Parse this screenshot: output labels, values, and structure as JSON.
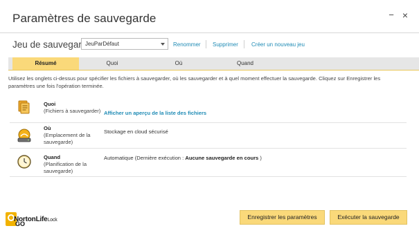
{
  "window": {
    "title": "Paramètres de sauvegarde",
    "minimize_glyph": "−",
    "close_glyph": "×"
  },
  "backup_set": {
    "label": "Jeu de sauvegarde",
    "selected": "JeuParDéfaut",
    "links": [
      "Renommer",
      "Supprimer",
      "Créer un nouveau jeu"
    ]
  },
  "tabs": [
    {
      "label": "Résumé",
      "active": true
    },
    {
      "label": "Quoi",
      "active": false
    },
    {
      "label": "Où",
      "active": false
    },
    {
      "label": "Quand",
      "active": false
    }
  ],
  "description": "Utilisez les onglets ci-dessus pour spécifier les fichiers à sauvegarder, où les sauvegarder et à quel moment effectuer la sauvegarde. Cliquez sur Enregistrer les paramètres une fois l'opération terminée.",
  "rows": {
    "what": {
      "title": "Quoi",
      "subtitle": "(Fichiers à sauvegarder)",
      "link": "Afficher un aperçu de la liste des fichiers",
      "icon": "files-icon"
    },
    "where": {
      "title": "Où",
      "subtitle": "(Emplacement de la sauvegarde)",
      "value": "Stockage en cloud sécurisé",
      "icon": "cloud-storage-icon"
    },
    "when": {
      "title": "Quand",
      "subtitle": "(Planification de la sauvegarde)",
      "value_prefix": "Automatique   (Dernière exécution : ",
      "value_bold": "Aucune sauvegarde en cours",
      "value_suffix": " )",
      "icon": "clock-icon"
    }
  },
  "footer": {
    "logo_main": "NortonLife",
    "logo_suffix": "Lock",
    "logo_overlay": "GO",
    "save_button": "Enregistrer les paramètres",
    "run_button": "Exécuter la sauvegarde"
  },
  "colors": {
    "accent": "#fad97a",
    "link": "#1f8bb5",
    "tab_bar": "#e6e6e6"
  }
}
